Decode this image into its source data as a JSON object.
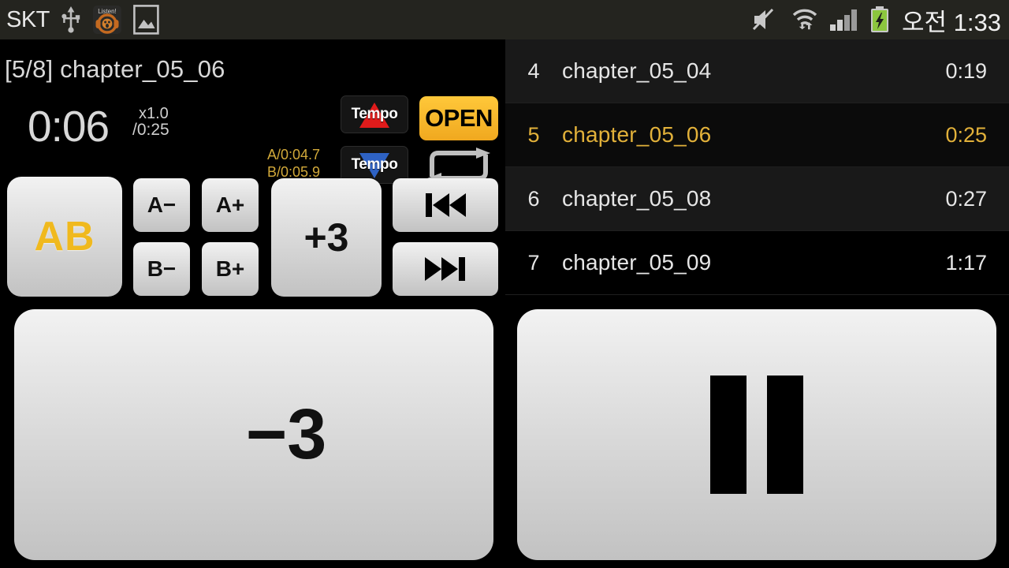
{
  "status_bar": {
    "carrier": "SKT",
    "clock": "오전 1:33",
    "left_icons": [
      "usb-icon",
      "listen-headphone-icon",
      "gallery-image-icon"
    ],
    "right_icons": [
      "mute-icon",
      "wifi-icon",
      "signal-bars-icon",
      "battery-charging-icon"
    ],
    "listen_badge": "Listen!"
  },
  "player": {
    "track_title": "[5/8] chapter_05_06",
    "elapsed": "0:06",
    "speed_rate": "x1.0",
    "total_time": "/0:25",
    "marker_a": "A/0:04.7",
    "marker_b": "B/0:05.9",
    "tempo_up_label": "Tempo",
    "tempo_down_label": "Tempo",
    "open_label": "OPEN",
    "loop_icon": "repeat-loop-icon"
  },
  "controls": {
    "ab_label": "AB",
    "a_minus": "A−",
    "a_plus": "A+",
    "b_minus": "B−",
    "b_plus": "B+",
    "plus3": "+3",
    "minus3": "−3",
    "prev_icon": "previous-track-icon",
    "next_icon": "next-track-icon",
    "pause_icon": "pause-icon"
  },
  "playlist": {
    "rows": [
      {
        "index": "4",
        "name": "chapter_05_04",
        "duration": "0:19",
        "current": false
      },
      {
        "index": "5",
        "name": "chapter_05_06",
        "duration": "0:25",
        "current": true
      },
      {
        "index": "6",
        "name": "chapter_05_08",
        "duration": "0:27",
        "current": false
      },
      {
        "index": "7",
        "name": "chapter_05_09",
        "duration": "1:17",
        "current": false
      }
    ]
  },
  "colors": {
    "accent_gold": "#e2b13a",
    "open_yellow": "#ffc83a",
    "tempo_up_red": "#e01b1b",
    "tempo_down_blue": "#2e62c4",
    "battery_green": "#8cc63e",
    "status_bar_bg": "#24241f"
  }
}
